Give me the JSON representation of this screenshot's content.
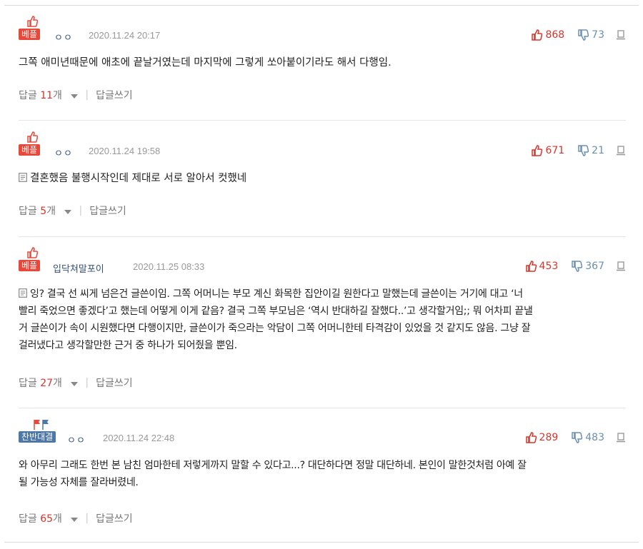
{
  "comments": [
    {
      "badge": "베플",
      "nickname": "ㅇㅇ",
      "date": "2020.11.24 20:17",
      "likes": "868",
      "dislikes": "73",
      "text": "그쪽 애미년때문에 애초에 끝날거였는데 마지막에 그렇게 쏘아붙이기라도 해서 다행임.",
      "reply_label": "답글",
      "reply_count": "11",
      "reply_unit": "개",
      "write_reply": "답글쓰기"
    },
    {
      "badge": "베플",
      "nickname": "ㅇㅇ",
      "date": "2020.11.24 19:58",
      "likes": "671",
      "dislikes": "21",
      "text": "결혼했음 불행시작인데 제대로 서로 알아서 컷했네",
      "reply_label": "답글",
      "reply_count": "5",
      "reply_unit": "개",
      "write_reply": "답글쓰기"
    },
    {
      "badge": "베플",
      "nickname": "입닥쳐말포이",
      "date": "2020.11.25 08:33",
      "likes": "453",
      "dislikes": "367",
      "text_lines": [
        "잉? 결국 선 씨게 넘은건 글쓴이임. 그쪽 어머니는 부모 계신 화목한 집안이길 원한다고 말했는데 글쓴이는 거기에 대고 ‘너",
        "빨리 죽었으면 좋겠다’고 했는데 어떻게 이게 같음? 결국 그쪽 부모님은 ‘역시 반대하길 잘했다..’고 생각할거임;; 뭐 어차피 끝낼",
        "거 글쓴이가 속이 시원했다면 다행이지만, 글쓴이가 죽으라는 악담이 그쪽 어머니한테 타격감이 있었을 것 같지도 않음. 그냥 잘",
        "걸러냈다고 생각할만한 근거 중 하나가 되어줬을 뿐임."
      ],
      "reply_label": "답글",
      "reply_count": "27",
      "reply_unit": "개",
      "write_reply": "답글쓰기"
    },
    {
      "badge": "찬반대결",
      "nickname": "ㅇㅇ",
      "date": "2020.11.24 22:48",
      "likes": "289",
      "dislikes": "483",
      "text_lines": [
        "와 아무리 그래도 한번 본 남친 엄마한테 저렇게까지 말할 수 있다고...? 대단하다면 정말 대단하네. 본인이 말한것처럼 아예 잘",
        "될 가능성 자체를 잘라버렸네."
      ],
      "reply_label": "답글",
      "reply_count": "65",
      "reply_unit": "개",
      "write_reply": "답글쓰기"
    }
  ],
  "colors": {
    "like": "#d8342b",
    "dislike": "#6a8fb3",
    "badge_best": "#e8483a",
    "badge_vs": "#4d78a6"
  },
  "icons": [
    "thumbs-up-icon",
    "thumbs-down-icon",
    "report-icon",
    "memo-icon",
    "flag-icon",
    "caret-down-icon"
  ]
}
